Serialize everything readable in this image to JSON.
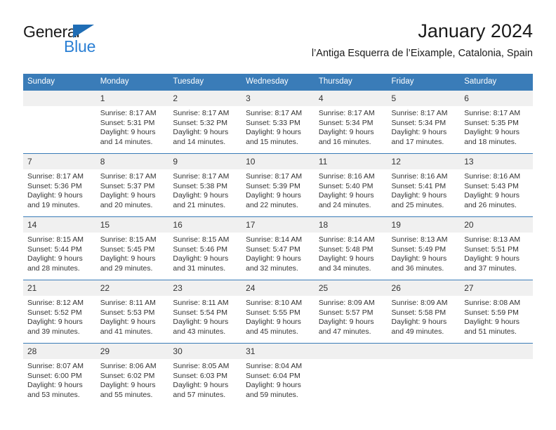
{
  "logo": {
    "word_one": "General",
    "word_two": "Blue",
    "triangle_icon": "triangle-icon",
    "accent_dark": "#1f6db5",
    "accent_light": "#2a7fd4"
  },
  "header": {
    "title": "January 2024",
    "subtitle": "l’Antiga Esquerra de l’Eixample, Catalonia, Spain"
  },
  "colors": {
    "header_blue": "#3a7cb8",
    "daynum_gray": "#f0f0f0",
    "text": "#333333"
  },
  "calendar": {
    "weekday_headers": [
      "Sunday",
      "Monday",
      "Tuesday",
      "Wednesday",
      "Thursday",
      "Friday",
      "Saturday"
    ],
    "weeks": [
      [
        {
          "day": "",
          "lines": []
        },
        {
          "day": "1",
          "lines": [
            "Sunrise: 8:17 AM",
            "Sunset: 5:31 PM",
            "Daylight: 9 hours",
            "and 14 minutes."
          ]
        },
        {
          "day": "2",
          "lines": [
            "Sunrise: 8:17 AM",
            "Sunset: 5:32 PM",
            "Daylight: 9 hours",
            "and 14 minutes."
          ]
        },
        {
          "day": "3",
          "lines": [
            "Sunrise: 8:17 AM",
            "Sunset: 5:33 PM",
            "Daylight: 9 hours",
            "and 15 minutes."
          ]
        },
        {
          "day": "4",
          "lines": [
            "Sunrise: 8:17 AM",
            "Sunset: 5:34 PM",
            "Daylight: 9 hours",
            "and 16 minutes."
          ]
        },
        {
          "day": "5",
          "lines": [
            "Sunrise: 8:17 AM",
            "Sunset: 5:34 PM",
            "Daylight: 9 hours",
            "and 17 minutes."
          ]
        },
        {
          "day": "6",
          "lines": [
            "Sunrise: 8:17 AM",
            "Sunset: 5:35 PM",
            "Daylight: 9 hours",
            "and 18 minutes."
          ]
        }
      ],
      [
        {
          "day": "7",
          "lines": [
            "Sunrise: 8:17 AM",
            "Sunset: 5:36 PM",
            "Daylight: 9 hours",
            "and 19 minutes."
          ]
        },
        {
          "day": "8",
          "lines": [
            "Sunrise: 8:17 AM",
            "Sunset: 5:37 PM",
            "Daylight: 9 hours",
            "and 20 minutes."
          ]
        },
        {
          "day": "9",
          "lines": [
            "Sunrise: 8:17 AM",
            "Sunset: 5:38 PM",
            "Daylight: 9 hours",
            "and 21 minutes."
          ]
        },
        {
          "day": "10",
          "lines": [
            "Sunrise: 8:17 AM",
            "Sunset: 5:39 PM",
            "Daylight: 9 hours",
            "and 22 minutes."
          ]
        },
        {
          "day": "11",
          "lines": [
            "Sunrise: 8:16 AM",
            "Sunset: 5:40 PM",
            "Daylight: 9 hours",
            "and 24 minutes."
          ]
        },
        {
          "day": "12",
          "lines": [
            "Sunrise: 8:16 AM",
            "Sunset: 5:41 PM",
            "Daylight: 9 hours",
            "and 25 minutes."
          ]
        },
        {
          "day": "13",
          "lines": [
            "Sunrise: 8:16 AM",
            "Sunset: 5:43 PM",
            "Daylight: 9 hours",
            "and 26 minutes."
          ]
        }
      ],
      [
        {
          "day": "14",
          "lines": [
            "Sunrise: 8:15 AM",
            "Sunset: 5:44 PM",
            "Daylight: 9 hours",
            "and 28 minutes."
          ]
        },
        {
          "day": "15",
          "lines": [
            "Sunrise: 8:15 AM",
            "Sunset: 5:45 PM",
            "Daylight: 9 hours",
            "and 29 minutes."
          ]
        },
        {
          "day": "16",
          "lines": [
            "Sunrise: 8:15 AM",
            "Sunset: 5:46 PM",
            "Daylight: 9 hours",
            "and 31 minutes."
          ]
        },
        {
          "day": "17",
          "lines": [
            "Sunrise: 8:14 AM",
            "Sunset: 5:47 PM",
            "Daylight: 9 hours",
            "and 32 minutes."
          ]
        },
        {
          "day": "18",
          "lines": [
            "Sunrise: 8:14 AM",
            "Sunset: 5:48 PM",
            "Daylight: 9 hours",
            "and 34 minutes."
          ]
        },
        {
          "day": "19",
          "lines": [
            "Sunrise: 8:13 AM",
            "Sunset: 5:49 PM",
            "Daylight: 9 hours",
            "and 36 minutes."
          ]
        },
        {
          "day": "20",
          "lines": [
            "Sunrise: 8:13 AM",
            "Sunset: 5:51 PM",
            "Daylight: 9 hours",
            "and 37 minutes."
          ]
        }
      ],
      [
        {
          "day": "21",
          "lines": [
            "Sunrise: 8:12 AM",
            "Sunset: 5:52 PM",
            "Daylight: 9 hours",
            "and 39 minutes."
          ]
        },
        {
          "day": "22",
          "lines": [
            "Sunrise: 8:11 AM",
            "Sunset: 5:53 PM",
            "Daylight: 9 hours",
            "and 41 minutes."
          ]
        },
        {
          "day": "23",
          "lines": [
            "Sunrise: 8:11 AM",
            "Sunset: 5:54 PM",
            "Daylight: 9 hours",
            "and 43 minutes."
          ]
        },
        {
          "day": "24",
          "lines": [
            "Sunrise: 8:10 AM",
            "Sunset: 5:55 PM",
            "Daylight: 9 hours",
            "and 45 minutes."
          ]
        },
        {
          "day": "25",
          "lines": [
            "Sunrise: 8:09 AM",
            "Sunset: 5:57 PM",
            "Daylight: 9 hours",
            "and 47 minutes."
          ]
        },
        {
          "day": "26",
          "lines": [
            "Sunrise: 8:09 AM",
            "Sunset: 5:58 PM",
            "Daylight: 9 hours",
            "and 49 minutes."
          ]
        },
        {
          "day": "27",
          "lines": [
            "Sunrise: 8:08 AM",
            "Sunset: 5:59 PM",
            "Daylight: 9 hours",
            "and 51 minutes."
          ]
        }
      ],
      [
        {
          "day": "28",
          "lines": [
            "Sunrise: 8:07 AM",
            "Sunset: 6:00 PM",
            "Daylight: 9 hours",
            "and 53 minutes."
          ]
        },
        {
          "day": "29",
          "lines": [
            "Sunrise: 8:06 AM",
            "Sunset: 6:02 PM",
            "Daylight: 9 hours",
            "and 55 minutes."
          ]
        },
        {
          "day": "30",
          "lines": [
            "Sunrise: 8:05 AM",
            "Sunset: 6:03 PM",
            "Daylight: 9 hours",
            "and 57 minutes."
          ]
        },
        {
          "day": "31",
          "lines": [
            "Sunrise: 8:04 AM",
            "Sunset: 6:04 PM",
            "Daylight: 9 hours",
            "and 59 minutes."
          ]
        },
        {
          "day": "",
          "lines": []
        },
        {
          "day": "",
          "lines": []
        },
        {
          "day": "",
          "lines": []
        }
      ]
    ]
  }
}
